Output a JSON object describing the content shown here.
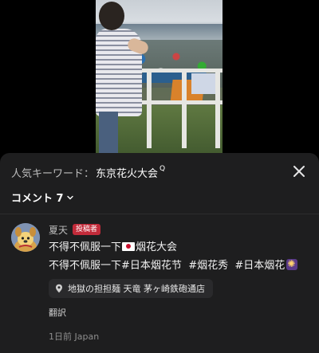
{
  "header": {
    "keyword_label": "人気キーワード：",
    "keyword_value": "东京花火大会",
    "search_mark": "Q"
  },
  "comments_header": {
    "label": "コメント 7"
  },
  "comment": {
    "user_name": "夏天",
    "author_badge": "投稿者",
    "line1_before_flag": "不得不佩服一下",
    "line1_after_flag": "烟花大会",
    "line2_text": "不得不佩服一下",
    "line2_tags": [
      "#日本烟花节",
      "#烟花秀",
      "#日本烟花"
    ],
    "location": "地獄の担担麺 天竜 茅ヶ崎鉄砲通店",
    "translate_label": "翻訳",
    "time_text": "1日前",
    "region_text": "Japan"
  },
  "icons": {
    "close": "close-icon",
    "chevron": "chevron-down-icon",
    "location": "location-pin-icon",
    "flag": "japan-flag-emoji",
    "firework": "firework-emoji"
  },
  "colors": {
    "sheet_bg": "#1e1e1f",
    "author_badge": "#c22b3a",
    "chip_bg": "#2a2a2c"
  }
}
